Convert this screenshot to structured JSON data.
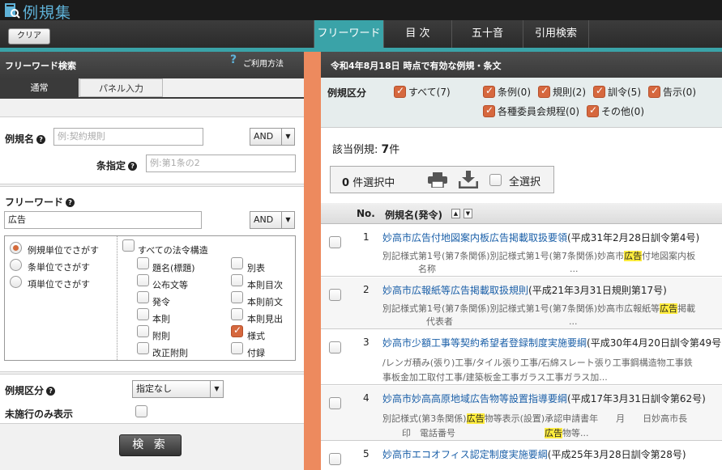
{
  "app": {
    "title": "例規集"
  },
  "toolbar": {
    "clear_label": "クリア"
  },
  "tabs": [
    {
      "label": "フリーワード",
      "active": true
    },
    {
      "label": "目 次",
      "active": false
    },
    {
      "label": "五十音",
      "active": false
    },
    {
      "label": "引用検索",
      "active": false
    }
  ],
  "left": {
    "header": "フリーワード検索",
    "help_label": "ご利用方法",
    "subtabs": [
      "通常",
      "パネル入力"
    ],
    "reiki_name_label": "例規名",
    "reiki_name_placeholder": "例:契約規則",
    "reiki_name_op": "AND",
    "article_label": "条指定",
    "article_placeholder": "例:第1条の2",
    "freeword_label": "フリーワード",
    "freeword_value": "広告",
    "freeword_op": "AND",
    "search_units": [
      {
        "label": "例規単位でさがす",
        "selected": true
      },
      {
        "label": "条単位でさがす",
        "selected": false
      },
      {
        "label": "項単位でさがす",
        "selected": false
      }
    ],
    "structure_all_label": "すべての法令構造",
    "structure_items": [
      {
        "label": "題名(標題)",
        "checked": false
      },
      {
        "label": "別表",
        "checked": false
      },
      {
        "label": "公布文等",
        "checked": false
      },
      {
        "label": "本則目次",
        "checked": false
      },
      {
        "label": "発令",
        "checked": false
      },
      {
        "label": "本則前文",
        "checked": false
      },
      {
        "label": "本則",
        "checked": false
      },
      {
        "label": "本則見出",
        "checked": false
      },
      {
        "label": "附則",
        "checked": false
      },
      {
        "label": "様式",
        "checked": true
      },
      {
        "label": "改正附則",
        "checked": false
      },
      {
        "label": "付録",
        "checked": false
      }
    ],
    "category_label": "例規区分",
    "category_value": "指定なし",
    "unenforced_label": "未施行のみ表示",
    "search_button": "検 索"
  },
  "right": {
    "header": "令和4年8月18日 時点で有効な例規・条文",
    "category_label": "例規区分",
    "categories": [
      {
        "label": "すべて(7)",
        "checked": true
      },
      {
        "label": "条例(0)",
        "checked": true
      },
      {
        "label": "規則(2)",
        "checked": true
      },
      {
        "label": "訓令(5)",
        "checked": true
      },
      {
        "label": "告示(0)",
        "checked": true
      },
      {
        "label": "各種委員会規程(0)",
        "checked": true
      },
      {
        "label": "その他(0)",
        "checked": true
      }
    ],
    "hit_label": "該当例規:",
    "hit_count": "7",
    "hit_unit": "件",
    "selected_count": "0",
    "selected_label": "件選択中",
    "select_all_label": "全選択",
    "col_no": "No.",
    "col_name": "例規名(発令)",
    "results": [
      {
        "no": "1",
        "title": "妙高市広告付地図案内板広告掲載取扱要領",
        "meta": "(平成31年2月28日訓令第4号)",
        "snip1_pre": "別記様式第1号(第7条関係)別記様式第1号(第7条関係)妙高市",
        "snip1_hl": "広告",
        "snip1_post": "付地図案内板",
        "snip2": "名称　　　　　　　　　　　　　　　..."
      },
      {
        "no": "2",
        "title": "妙高市広報紙等広告掲載取扱規則",
        "meta": "(平成21年3月31日規則第17号)",
        "snip1_pre": "別記様式第1号(第7条関係)別記様式第1号(第7条関係)妙高市広報紙等",
        "snip1_hl": "広告",
        "snip1_post": "掲載",
        "snip2": "代表者　　　　　　　　　　　　　..."
      },
      {
        "no": "3",
        "title": "妙高市少額工事等契約希望者登録制度実施要綱",
        "meta": "(平成30年4月20日訓令第49号)",
        "snip1_pre": "/レンガ積み(張り)工事/タイル張り工事/石綿スレート張り工事鋼構造物工事鉄",
        "snip1_hl": "",
        "snip1_post": "",
        "snip2": "事板金加工取付工事/建築板金工事ガラス工事ガラス加..."
      },
      {
        "no": "4",
        "title": "妙高市妙高高原地域広告物等設置指導要綱",
        "meta": "(平成17年3月31日訓令第62号)",
        "snip1_pre": "別記様式(第3条関係)",
        "snip1_hl": "広告",
        "snip1_post": "物等表示(設置)承認申請書年　　月　　日妙高市長",
        "snip2_pre": "印　電話番号　　　　　　　　　　",
        "snip2_hl": "広告",
        "snip2_post": "物等..."
      },
      {
        "no": "5",
        "title": "妙高市エコオフィス認定制度実施要綱",
        "meta": "(平成25年3月28日訓令第28号)"
      }
    ]
  }
}
